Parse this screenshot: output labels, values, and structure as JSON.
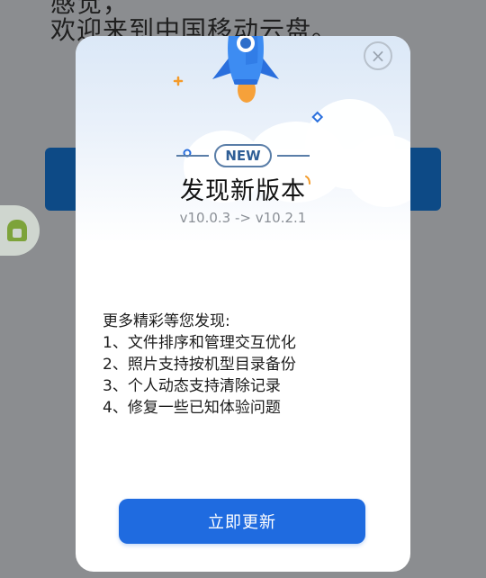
{
  "background": {
    "line1": "感觉，",
    "line2": "欢迎来到中国移动云盘。"
  },
  "dialog": {
    "badge": "NEW",
    "title": "发现新版本",
    "version": "v10.0.3 -> v10.2.1",
    "notes_heading": "更多精彩等您发现:",
    "notes": [
      "1、文件排序和管理交互优化",
      "2、照片支持按机型目录备份",
      "3、个人动态支持清除记录",
      "4、修复一些已知体验问题"
    ],
    "update_button": "立即更新",
    "close_symbol": "×"
  },
  "colors": {
    "accent": "#1f6be0",
    "badge": "#2f5e96"
  }
}
